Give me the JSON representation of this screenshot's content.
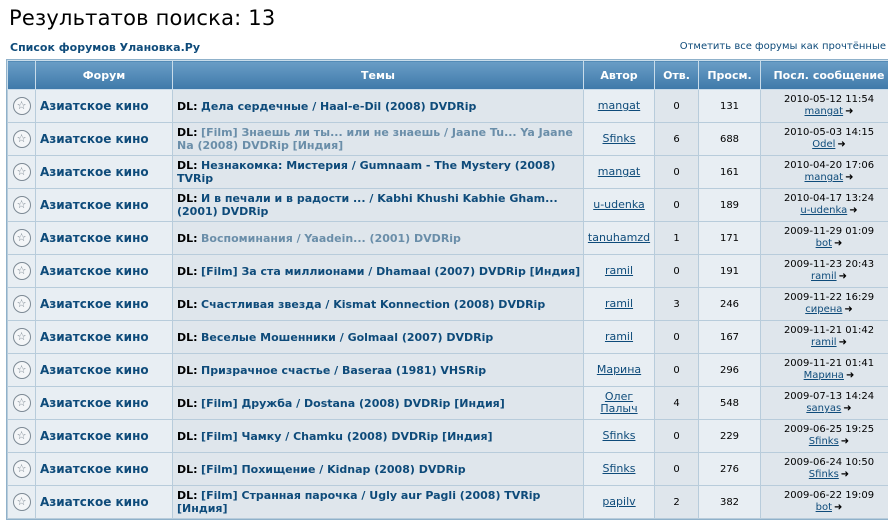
{
  "page": {
    "title": "Результатов поиска: 13",
    "forum_list_link": "Список форумов Улановка.Ру",
    "mark_read_link": "Отметить все форумы как прочтённые"
  },
  "table": {
    "headers": [
      "Форум",
      "Темы",
      "Автор",
      "Отв.",
      "Просм.",
      "Посл. сообщение"
    ],
    "rows": [
      {
        "forum": "Азиатское кино",
        "dl": "DL:",
        "topic": "Дела сердечные / Haal-e-Dil (2008) DVDRip",
        "visited": false,
        "author": "mangat",
        "replies": "0",
        "views": "131",
        "last_date": "2010-05-12 11:54",
        "last_author": "mangat"
      },
      {
        "forum": "Азиатское кино",
        "dl": "DL:",
        "topic": "[Film] Знаешь ли ты... или не знаешь / Jaane Tu... Ya Jaane Na (2008) DVDRip [Индия]",
        "visited": true,
        "author": "Sfinks",
        "replies": "6",
        "views": "688",
        "last_date": "2010-05-03 14:15",
        "last_author": "Odel"
      },
      {
        "forum": "Азиатское кино",
        "dl": "DL:",
        "topic": "Незнакомка: Мистерия / Gumnaam - The Mystery (2008) TVRip",
        "visited": false,
        "author": "mangat",
        "replies": "0",
        "views": "161",
        "last_date": "2010-04-20 17:06",
        "last_author": "mangat"
      },
      {
        "forum": "Азиатское кино",
        "dl": "DL:",
        "topic": "И в печали и в радости ... / Kabhi Khushi Kabhie Gham... (2001) DVDRip",
        "visited": false,
        "author": "u-udenka",
        "replies": "0",
        "views": "189",
        "last_date": "2010-04-17 13:24",
        "last_author": "u-udenka"
      },
      {
        "forum": "Азиатское кино",
        "dl": "DL:",
        "topic": "Воспоминания / Yaadein... (2001) DVDRip",
        "visited": true,
        "author": "tanuhamzd",
        "replies": "1",
        "views": "171",
        "last_date": "2009-11-29 01:09",
        "last_author": "bot"
      },
      {
        "forum": "Азиатское кино",
        "dl": "DL:",
        "topic": "[Film] За ста миллионами / Dhamaal (2007) DVDRip [Индия]",
        "visited": false,
        "author": "ramil",
        "replies": "0",
        "views": "191",
        "last_date": "2009-11-23 20:43",
        "last_author": "ramil"
      },
      {
        "forum": "Азиатское кино",
        "dl": "DL:",
        "topic": "Счастливая звезда / Kismat Konnection (2008) DVDRip",
        "visited": false,
        "author": "ramil",
        "replies": "3",
        "views": "246",
        "last_date": "2009-11-22 16:29",
        "last_author": "сирена"
      },
      {
        "forum": "Азиатское кино",
        "dl": "DL:",
        "topic": "Веселые Мошенники / Golmaal (2007) DVDRip",
        "visited": false,
        "author": "ramil",
        "replies": "0",
        "views": "167",
        "last_date": "2009-11-21 01:42",
        "last_author": "ramil"
      },
      {
        "forum": "Азиатское кино",
        "dl": "DL:",
        "topic": "Призрачное счастье / Baseraa (1981) VHSRip",
        "visited": false,
        "author": "Марина",
        "replies": "0",
        "views": "296",
        "last_date": "2009-11-21 01:41",
        "last_author": "Марина"
      },
      {
        "forum": "Азиатское кино",
        "dl": "DL:",
        "topic": "[Film] Дружба / Dostana (2008) DVDRip [Индия]",
        "visited": false,
        "author": "Олег Палыч",
        "replies": "4",
        "views": "548",
        "last_date": "2009-07-13 14:24",
        "last_author": "sanyas"
      },
      {
        "forum": "Азиатское кино",
        "dl": "DL:",
        "topic": "[Film] Чамку / Chamku (2008) DVDRip [Индия]",
        "visited": false,
        "author": "Sfinks",
        "replies": "0",
        "views": "229",
        "last_date": "2009-06-25 19:25",
        "last_author": "Sfinks"
      },
      {
        "forum": "Азиатское кино",
        "dl": "DL:",
        "topic": "[Film] Похищение / Kidnap (2008) DVDRip",
        "visited": false,
        "author": "Sfinks",
        "replies": "0",
        "views": "276",
        "last_date": "2009-06-24 10:50",
        "last_author": "Sfinks"
      },
      {
        "forum": "Азиатское кино",
        "dl": "DL:",
        "topic": "[Film] Странная парочка / Ugly aur Pagli (2008) TVRip [Индия]",
        "visited": false,
        "author": "papilv",
        "replies": "2",
        "views": "382",
        "last_date": "2009-06-22 19:09",
        "last_author": "bot"
      }
    ]
  },
  "icons": {
    "row_icon": "star-circle-icon",
    "goto_icon": "goto-last-post-icon"
  }
}
